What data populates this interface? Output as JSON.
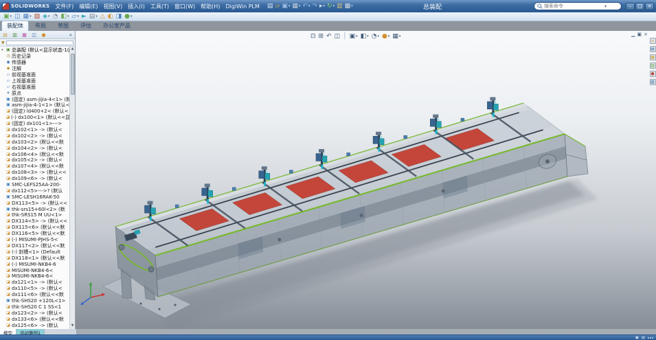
{
  "titlebar": {
    "logo_text": "SOLIDWORKS",
    "title": "总装配",
    "menus": [
      "文件(F)",
      "编辑(E)",
      "视图(V)",
      "插入(I)",
      "工具(T)",
      "窗口(W)",
      "帮助(H)",
      "DigiWin PLM"
    ],
    "quick_icons": [
      {
        "name": "new-document-icon",
        "glyph": "▤",
        "color": "#dbe7f5"
      },
      {
        "name": "open-document-icon",
        "glyph": "▱",
        "color": "#e5b63f"
      },
      {
        "name": "save-icon",
        "glyph": "▣",
        "color": "#9fc0e8",
        "caret": true
      },
      {
        "name": "print-icon",
        "glyph": "▦",
        "color": "#c3cfdc",
        "caret": true
      },
      {
        "name": "undo-icon",
        "glyph": "↶",
        "color": "#8db4e2",
        "caret": true
      },
      {
        "name": "redo-icon",
        "glyph": "↷",
        "color": "#8db4e2"
      },
      {
        "name": "select-icon",
        "glyph": "▸",
        "color": "#d8e2ee",
        "caret": true
      },
      {
        "name": "rebuild-icon",
        "glyph": "↻",
        "color": "#8bd06a",
        "caret": true
      },
      {
        "name": "file-properties-icon",
        "glyph": "▥",
        "color": "#d8c27a"
      },
      {
        "name": "options-icon",
        "glyph": "▩",
        "color": "#cdd9e5",
        "caret": true
      }
    ],
    "search": {
      "placeholder": "搜索命令"
    },
    "window_controls": [
      {
        "name": "minimize-button",
        "glyph": "–"
      },
      {
        "name": "restore-button",
        "glyph": "□"
      },
      {
        "name": "close-button",
        "glyph": "×"
      }
    ]
  },
  "toolbar": {
    "icons": [
      {
        "name": "insert-component-icon",
        "glyph": "▣",
        "color": "#6aa84f",
        "caret": true
      },
      {
        "name": "mate-icon",
        "glyph": "◫",
        "color": "#4a7ebf"
      },
      {
        "name": "linear-pattern-icon",
        "glyph": "▦",
        "color": "#4a7ebf",
        "caret": true
      },
      {
        "name": "smart-fasteners-icon",
        "glyph": "▧",
        "color": "#b54f3a"
      },
      {
        "name": "move-component-icon",
        "glyph": "◈",
        "color": "#2fa8b5",
        "caret": true
      },
      {
        "name": "show-hidden-components-icon",
        "glyph": "◔",
        "color": "#7d8a98"
      },
      {
        "name": "assembly-features-icon",
        "glyph": "◧",
        "color": "#6aa84f",
        "caret": true
      },
      {
        "name": "reference-geometry-icon",
        "glyph": "▱",
        "color": "#4a7ebf",
        "caret": true
      },
      {
        "name": "new-motion-study-icon",
        "glyph": "►",
        "color": "#2fa8b5"
      },
      {
        "name": "bill-of-materials-icon",
        "glyph": "▤",
        "color": "#7d8a98",
        "caret": true
      },
      {
        "name": "exploded-view-icon",
        "glyph": "△",
        "color": "#d2912f"
      },
      {
        "name": "instant3d-icon",
        "glyph": "◐",
        "color": "#d2912f"
      },
      {
        "name": "external-references-icon",
        "glyph": "◨",
        "color": "#4a7ebf"
      },
      {
        "name": "simulation-icon",
        "glyph": "●",
        "color": "#6aa84f",
        "caret": true
      }
    ]
  },
  "ribbon_tabs": {
    "items": [
      {
        "name": "tab-assembly",
        "label": "装配体",
        "state": "active"
      },
      {
        "name": "tab-layout",
        "label": "布局",
        "state": "normal"
      },
      {
        "name": "tab-sketch",
        "label": "草图",
        "state": "normal"
      },
      {
        "name": "tab-evaluate",
        "label": "评估",
        "state": "normal"
      },
      {
        "name": "tab-office-products",
        "label": "办公室产品",
        "state": "normal"
      }
    ]
  },
  "sidebar": {
    "panel_tabs": [
      {
        "name": "featuremanager-tab-icon",
        "glyph": "▤",
        "color": "#c99b3f"
      },
      {
        "name": "propertymanager-tab-icon",
        "glyph": "▥",
        "color": "#4f8f3a"
      },
      {
        "name": "configurationmanager-tab-icon",
        "glyph": "▦",
        "color": "#b54f9e"
      },
      {
        "name": "dimxpertmanager-tab-icon",
        "glyph": "◫",
        "color": "#3a6ea5"
      },
      {
        "name": "displaymanager-tab-icon",
        "glyph": "●",
        "color": "#d2912f"
      }
    ],
    "chevron": "»",
    "filter_icon": "▼",
    "root": {
      "label": "总装配 (默认<显示状态-1@"
    },
    "items": [
      {
        "icon": "history",
        "label": "历史记录"
      },
      {
        "icon": "sensors",
        "label": "传感器"
      },
      {
        "icon": "annot",
        "label": "注解"
      },
      {
        "icon": "plane",
        "label": "前视基准面"
      },
      {
        "icon": "plane",
        "label": "上视基准面"
      },
      {
        "icon": "plane",
        "label": "右视基准面"
      },
      {
        "icon": "origin",
        "label": "原点"
      },
      {
        "icon": "asm",
        "label": "(固定) asm-jijia-4<1> (默"
      },
      {
        "icon": "asm",
        "label": "asm-jijia-4-1<1> (默认<"
      },
      {
        "icon": "part",
        "label": "(固定) ld400+2< (默认<"
      },
      {
        "icon": "part",
        "label": "(-) dx100<1> (默认<<显示"
      },
      {
        "icon": "part",
        "label": "(固定) dx101<1>--->"
      },
      {
        "icon": "part",
        "label": "dx102<1> -> (默认<"
      },
      {
        "icon": "part",
        "label": "dx102<2> -> (默认<"
      },
      {
        "icon": "part",
        "label": "dx103<2> (默认<<默"
      },
      {
        "icon": "part",
        "label": "dx104<2> -> (默认<"
      },
      {
        "icon": "part",
        "label": "dx106<4> (默认<<默"
      },
      {
        "icon": "part",
        "label": "dx105<2> -> (默认<"
      },
      {
        "icon": "part",
        "label": "dx107<4> (默认<<默"
      },
      {
        "icon": "part",
        "label": "dx108<3> -> (默认<<"
      },
      {
        "icon": "part",
        "label": "dx109<6> -> (默认<"
      },
      {
        "icon": "asm",
        "label": "SMC-LEFS25AA-200-"
      },
      {
        "icon": "part",
        "label": "dx112<5>--->? (默认"
      },
      {
        "icon": "asm",
        "label": "SMC-LESH16RAK-50"
      },
      {
        "icon": "part",
        "label": "DX113<5> -> (默认<<"
      },
      {
        "icon": "asm",
        "label": "thk-srs15+60l<2> (默"
      },
      {
        "icon": "part",
        "label": "thk-SRS15 M UU<1>"
      },
      {
        "icon": "part",
        "label": "DX114<5> -> (默认<<"
      },
      {
        "icon": "part",
        "label": "DX115<6> (默认<<默"
      },
      {
        "icon": "part",
        "label": "DX116<5> (默认<<默"
      },
      {
        "icon": "part",
        "label": "(-) MISUMI-PJHS-5<"
      },
      {
        "icon": "part",
        "label": "DX117<2> (默认<<默"
      },
      {
        "icon": "part",
        "label": "(-) 封槽<1> (Default"
      },
      {
        "icon": "part",
        "label": "DX118<1> (默认<<默"
      },
      {
        "icon": "part",
        "label": "(-) MISUMI-NKB4-6"
      },
      {
        "icon": "part",
        "label": "MISUMI-NKB4-6<"
      },
      {
        "icon": "part",
        "label": "MISUMI-NKB4-6<"
      },
      {
        "icon": "part",
        "label": "dx121<1> -> (默认<"
      },
      {
        "icon": "part",
        "label": "dx110<5> -> (默认<"
      },
      {
        "icon": "part",
        "label": "dx111<6> (默认<<默"
      },
      {
        "icon": "asm",
        "label": "thk-SHS20 +120L<1>"
      },
      {
        "icon": "part",
        "label": "thk-SHS20 C 1 SS<1"
      },
      {
        "icon": "part",
        "label": "dx123<2> -> (默认<"
      },
      {
        "icon": "part",
        "label": "dx133<6> (默认<<默"
      },
      {
        "icon": "part",
        "label": "dx125<6> -> (默认"
      }
    ],
    "bottom_tabs": [
      {
        "name": "tab-model",
        "label": "模型",
        "state": "active"
      },
      {
        "name": "tab-motion-study-1",
        "label": "运动算例1",
        "state": "highlight"
      }
    ]
  },
  "viewport": {
    "hud_icons": [
      {
        "name": "zoom-fit-icon",
        "glyph": "⊡"
      },
      {
        "name": "zoom-area-icon",
        "glyph": "⊞"
      },
      {
        "name": "previous-view-icon",
        "glyph": "↶"
      },
      {
        "name": "section-view-icon",
        "glyph": "◫"
      },
      {
        "name": "toolbar-separator",
        "glyph": "│",
        "color": "#9bb0c4"
      },
      {
        "name": "view-orientation-icon",
        "glyph": "▣",
        "caret": true
      },
      {
        "name": "display-style-icon",
        "glyph": "◧",
        "caret": true
      },
      {
        "name": "hide-show-items-icon",
        "glyph": "◔",
        "caret": true
      },
      {
        "name": "edit-appearance-icon",
        "glyph": "●",
        "color": "#d2912f",
        "caret": true
      },
      {
        "name": "apply-scene-icon",
        "glyph": "▦",
        "caret": true
      }
    ],
    "doc_controls": [
      {
        "name": "doc-minimize-icon",
        "glyph": "▁"
      },
      {
        "name": "doc-restore-icon",
        "glyph": "▣"
      },
      {
        "name": "doc-close-icon",
        "glyph": "×"
      }
    ],
    "right_rail": [
      {
        "name": "task-pane-resources-icon",
        "glyph": "⌂",
        "color": "#d2912f"
      },
      {
        "name": "design-library-icon",
        "glyph": "▤",
        "color": "#3a6ea5"
      },
      {
        "name": "file-explorer-icon",
        "glyph": "▦",
        "color": "#c9a23a"
      },
      {
        "name": "view-palette-icon",
        "glyph": "▥",
        "color": "#5a9e3a"
      },
      {
        "name": "appearances-scenes-icon",
        "glyph": "●",
        "color": "#b5483a"
      },
      {
        "name": "custom-properties-icon",
        "glyph": "▧",
        "color": "#3a6ea5"
      }
    ]
  },
  "statusbar": {
    "right_icons": [
      {
        "name": "status-display-icon",
        "glyph": "▣"
      },
      {
        "name": "status-edit-icon",
        "glyph": "▤"
      }
    ]
  }
}
